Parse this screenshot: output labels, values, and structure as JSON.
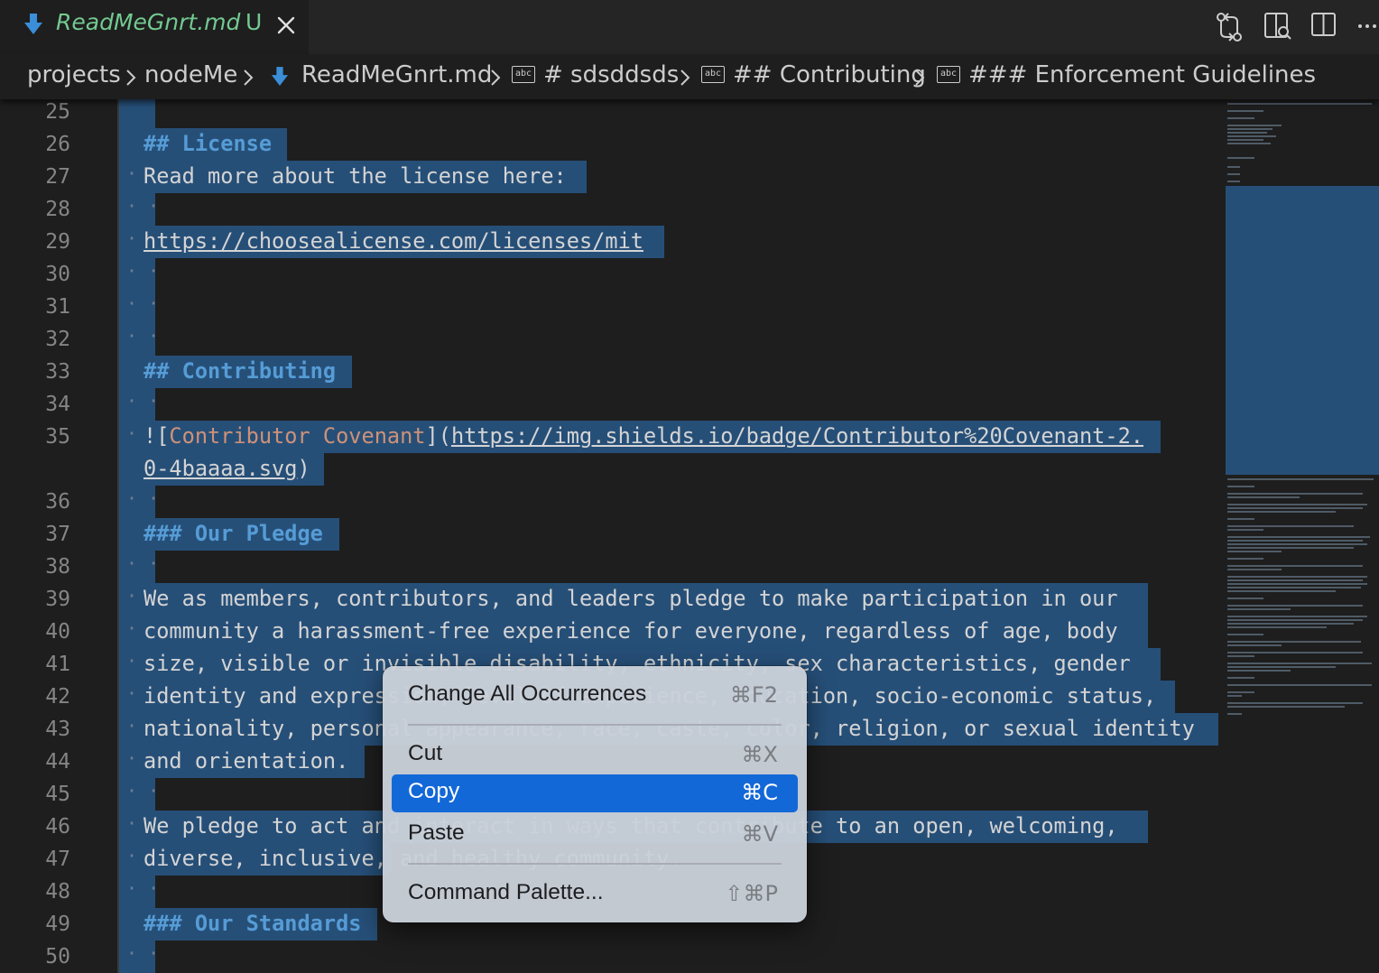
{
  "tab": {
    "title": "ReadMeGnrt.md",
    "status": "U",
    "file_icon": "markdown-arrow-icon",
    "close_icon": "close-icon"
  },
  "toolbar": {
    "actions": [
      "compare-changes-icon",
      "open-preview-side-icon",
      "split-editor-icon",
      "more-actions-icon"
    ]
  },
  "breadcrumb": {
    "items": [
      "projects",
      "nodeMe",
      "ReadMeGnrt.md",
      "# sdsddsds",
      "## Contributing",
      "### Enforcement Guidelines"
    ],
    "symbol_icon_text": "abc"
  },
  "editor": {
    "line_numbers": [
      "25",
      "26",
      "27",
      "28",
      "29",
      "30",
      "31",
      "32",
      "33",
      "34",
      "35",
      "36",
      "37",
      "38",
      "39",
      "40",
      "41",
      "42",
      "43",
      "44",
      "45",
      "46",
      "47",
      "48",
      "49",
      "50"
    ],
    "lines": {
      "l26_marker": "##",
      "l26_text": "License",
      "l27": "Read more about the license here:",
      "l29": "https://choosealicense.com/licenses/mit",
      "l33_marker": "##",
      "l33_text": "Contributing",
      "l35_bang": "![",
      "l35_alt": "Contributor Covenant",
      "l35_mid": "](",
      "l35_url": "https://img.shields.io/badge/Contributor%20Covenant-2.",
      "l35b_url": "0-4baaaa.svg",
      "l35b_end": ")",
      "l37_marker": "###",
      "l37_text": "Our Pledge",
      "l39": "We as members, contributors, and leaders pledge to make participation in our",
      "l40": "community a harassment-free experience for everyone, regardless of age, body",
      "l41": "size, visible or invisible disability, ethnicity, sex characteristics, gender",
      "l42": "identity and expression, level of experience, education, socio-economic status,",
      "l43": "nationality, personal appearance, race, caste, color, religion, or sexual identity",
      "l44": "and orientation.",
      "l46": "We pledge to act and interact in ways that contribute to an open, welcoming,",
      "l47": "diverse, inclusive, and healthy community.",
      "l49_marker": "###",
      "l49_text": "Our Standards"
    }
  },
  "context_menu": {
    "items": [
      {
        "label": "Change All Occurrences",
        "shortcut": "⌘F2"
      },
      {
        "label": "Cut",
        "shortcut": "⌘X"
      },
      {
        "label": "Copy",
        "shortcut": "⌘C"
      },
      {
        "label": "Paste",
        "shortcut": "⌘V"
      },
      {
        "label": "Command Palette...",
        "shortcut": "⇧⌘P"
      }
    ],
    "active_item": "Copy"
  },
  "colors": {
    "tab_title": "#73c991",
    "selection": "#264f78",
    "menu_highlight": "#1368d8",
    "heading": "#569cd6",
    "link_text": "#ce9178"
  }
}
